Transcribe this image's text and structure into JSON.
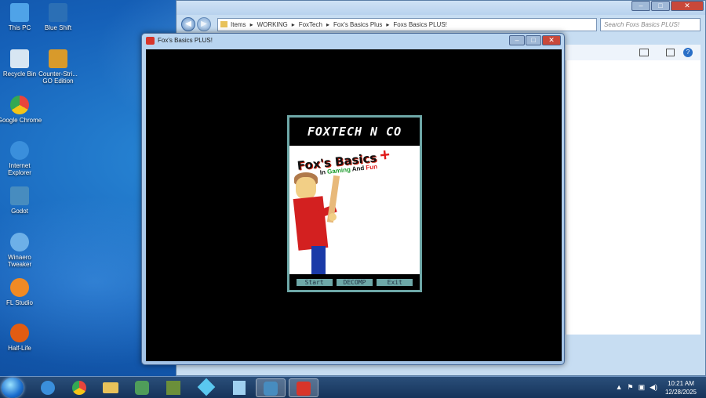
{
  "desktop": {
    "icons": [
      {
        "label": "This PC",
        "color": "#4fa3e8"
      },
      {
        "label": "Blue Shift",
        "color": "#2b6fb5"
      },
      {
        "label": "Recycle Bin",
        "color": "#d7e6f2"
      },
      {
        "label": "Counter-Stri... GO Edition",
        "color": "#d89a2b"
      },
      {
        "label": "Google Chrome",
        "color": "#e8453c"
      },
      {
        "label": "Internet Explorer",
        "color": "#3a8fdc"
      },
      {
        "label": "Godot",
        "color": "#478cbf"
      },
      {
        "label": "Winaero Tweaker",
        "color": "#6db0e8"
      },
      {
        "label": "FL Studio",
        "color": "#f08a24"
      },
      {
        "label": "Half-Life",
        "color": "#e25c12"
      }
    ]
  },
  "explorer": {
    "breadcrumb": [
      "Items",
      "WORKING",
      "FoxTech",
      "Fox's Basics Plus",
      "Foxs Basics PLUS!"
    ],
    "search_placeholder": "Search Foxs Basics PLUS!"
  },
  "game_window": {
    "title": "Fox's Basics PLUS!",
    "header": "FOXTECH N CO",
    "logo_line1": "Fox's Basics",
    "logo_plus": "+",
    "logo_line2_a": "In",
    "logo_line2_b": "Gaming",
    "logo_line2_c": "And",
    "logo_line2_d": "Fun",
    "buttons": [
      "Start",
      "DECOMP",
      "Exit"
    ]
  },
  "taskbar": {
    "apps": [
      "internet-explorer",
      "chrome",
      "file-explorer",
      "people",
      "minecraft",
      "kodi",
      "notes",
      "godot",
      "foxs-basics"
    ],
    "time": "10:21 AM",
    "date": "12/28/2025"
  },
  "colors": {
    "menu_accent": "#6ea8a8",
    "taskbar": "#1e406a"
  }
}
